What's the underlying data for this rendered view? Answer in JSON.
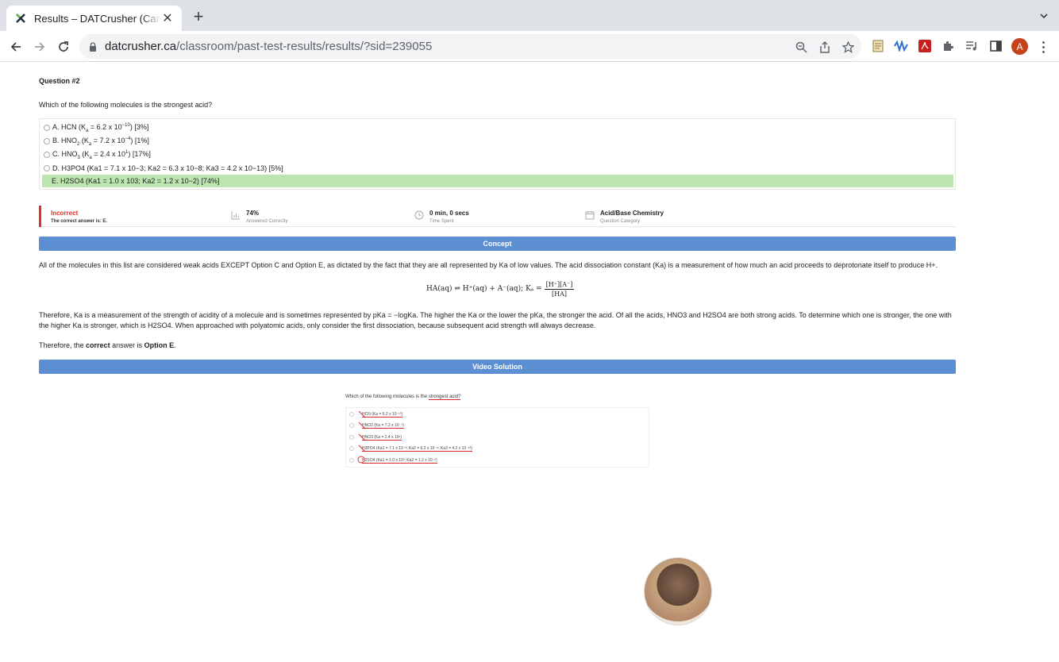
{
  "browser": {
    "tab_title": "Results – DATCrusher (Canadian)",
    "url_domain": "datcrusher.ca",
    "url_path": "/classroom/past-test-results/results/?sid=239055",
    "avatar_letter": "A"
  },
  "question": {
    "number": "Question #2",
    "text": "Which of the following molecules is the strongest acid?",
    "options": [
      {
        "prefix": "A. HCN (K",
        "sub1": "a",
        "mid": " = 6.2 x 10",
        "sup1": "−10",
        "suffix": ") [3%]"
      },
      {
        "prefix": "B. HNO",
        "sub0": "2",
        "pre2": " (K",
        "sub1": "a",
        "mid": " = 7.2 x 10",
        "sup1": "−4",
        "suffix": ") [1%]"
      },
      {
        "prefix": "C. HNO",
        "sub0": "3",
        "pre2": " (K",
        "sub1": "a",
        "mid": " = 2.4 x 10",
        "sup1": "1",
        "suffix": ") [17%]"
      },
      {
        "text": "D. H3PO4 (Ka1 = 7.1 x 10−3; Ka2 = 6.3 x 10−8; Ka3 = 4.2 x 10−13) [5%]"
      },
      {
        "text": "E. H2SO4 (Ka1 = 1.0 x 103; Ka2 = 1.2 x 10−2) [74%]"
      }
    ]
  },
  "stats": {
    "result": "Incorrect",
    "correct_answer": "The correct answer is: E.",
    "percent": "74%",
    "percent_label": "Answered Correctly",
    "time": "0 min, 0 secs",
    "time_label": "Time Spent",
    "category": "Acid/Base Chemistry",
    "category_label": "Question Category"
  },
  "concept": {
    "banner": "Concept",
    "para1": "All of the molecules in this list are considered weak acids EXCEPT Option C and Option E, as dictated by the fact that they are all represented by Ka of low values. The acid dissociation constant (Ka) is a measurement of how much an acid proceeds to deprotonate itself to produce H+.",
    "equation": "HA(aq) ⇌ H⁺(aq) + A⁻(aq); Kₐ =",
    "eq_num": "[H⁺][A⁻]",
    "eq_den": "[HA]",
    "para2": "Therefore, Ka is a measurement of the strength of acidity of a molecule and is sometimes represented by pKa = −logKa. The higher the Ka or the lower the pKa, the stronger the acid. Of all the acids, HNO3 and H2SO4 are both strong acids. To determine which one is stronger, the one with the higher Ka is stronger, which is H2SO4. When approached with polyatomic acids, only consider the first dissociation, because subsequent acid strength will always decrease.",
    "conclusion_prefix": "Therefore, the ",
    "conclusion_bold1": "correct",
    "conclusion_mid": " answer is ",
    "conclusion_bold2": "Option E",
    "conclusion_end": "."
  },
  "video": {
    "banner": "Video Solution",
    "question_prefix": "Which of the following molecules is the ",
    "question_highlight": "strongest acid?",
    "options": [
      "HCN (Ka = 6.2 x 10⁻¹⁰)",
      "HNO2 (Ka = 7.2 x 10⁻⁴)",
      "HNO3 (Ka = 2.4 x 10¹)",
      "H3PO4 (Ka1 = 7.1 x 10⁻³; Ka2 = 6.3 x 10⁻⁸; Ka3 = 4.2 x 10⁻¹³)",
      "H2SO4 (Ka1 = 1.0 x 10³; Ka2 = 1.2 x 10⁻²)"
    ]
  },
  "colors": {
    "correct_bg": "#bde5b0",
    "incorrect": "#d9342b",
    "banner": "#5b8fd1"
  }
}
